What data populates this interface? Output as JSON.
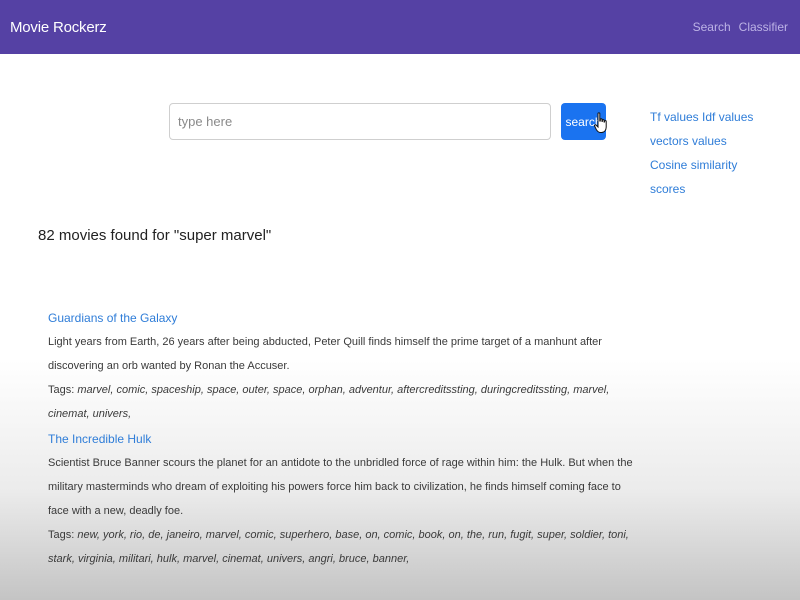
{
  "navbar": {
    "brand": "Movie Rockerz",
    "links": [
      "Search",
      "Classifier"
    ]
  },
  "search": {
    "placeholder": "type here",
    "value": "",
    "button_label": "search"
  },
  "side_links": [
    "Tf values Idf values",
    "vectors values",
    "Cosine similarity",
    "scores"
  ],
  "results_heading": "82 movies found for \"super marvel\"",
  "results": [
    {
      "title": "Guardians of the Galaxy",
      "description": "Light years from Earth, 26 years after being abducted, Peter Quill finds himself the prime target of a manhunt after discovering an orb wanted by Ronan the Accuser.",
      "tags_label": "Tags:",
      "tags": "marvel, comic, spaceship, space, outer, space, orphan, adventur, aftercreditssting, duringcreditssting, marvel, cinemat, univers,"
    },
    {
      "title": "The Incredible Hulk",
      "description": "Scientist Bruce Banner scours the planet for an antidote to the unbridled force of rage within him: the Hulk. But when the military masterminds who dream of exploiting his powers force him back to civilization, he finds himself coming face to face with a new, deadly foe.",
      "tags_label": "Tags:",
      "tags": "new, york, rio, de, janeiro, marvel, comic, superhero, base, on, comic, book, on, the, run, fugit, super, soldier, toni, stark, virginia, militari, hulk, marvel, cinemat, univers, angri, bruce, banner,"
    }
  ]
}
